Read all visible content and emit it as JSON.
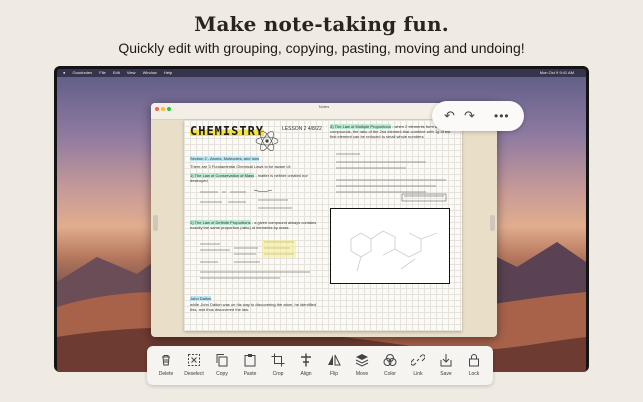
{
  "headline": "Make note-taking fun.",
  "subhead": "Quickly edit with grouping, copying, pasting, moving and undoing!",
  "menubar": {
    "items": [
      "Goodnotes",
      "File",
      "Edit",
      "View",
      "Window",
      "Help"
    ],
    "clock": "Mon Oct 9 9:41 AM"
  },
  "window": {
    "title": "Notes"
  },
  "note": {
    "title": "CHEMISTRY",
    "lesson": "LESSON 2   4/8/22",
    "section": "Section 2 - Atoms, Molecules, and Ions",
    "line1": "There are 3 Fundamental Chemical Laws to be aware of:",
    "law1": "1) The Law of Conservation of Mass",
    "law1_desc": "- matter is neither created nor destroyed",
    "law2": "2) The Law of Definite Proportions",
    "law2_desc": "- a given compound always contains exactly the same proportion (ratio) of elements by mass",
    "law3": "3) The Law of Multiple Proportions",
    "law3_desc": "- when 2 elements form a series of compounds, the ratio of the 2nd element that combine with 1g of the first element can be reduced to small whole numbers",
    "person": "John Dalton",
    "footer": "while John Dalton was on his way to discovering the atom, he identified this, and thus discovered the law."
  },
  "undo_bar": {
    "undo_icon": "undo-icon",
    "redo_icon": "redo-icon",
    "more_icon": "more-icon"
  },
  "toolbar": {
    "tools": [
      {
        "label": "Delete",
        "icon": "trash-icon"
      },
      {
        "label": "Deselect",
        "icon": "deselect-icon"
      },
      {
        "label": "Copy",
        "icon": "copy-icon"
      },
      {
        "label": "Paste",
        "icon": "paste-icon"
      },
      {
        "label": "Crop",
        "icon": "crop-icon"
      },
      {
        "label": "Align",
        "icon": "align-icon"
      },
      {
        "label": "Flip",
        "icon": "flip-icon"
      },
      {
        "label": "Move",
        "icon": "move-icon"
      },
      {
        "label": "Color",
        "icon": "color-icon"
      },
      {
        "label": "Link",
        "icon": "link-icon"
      },
      {
        "label": "Save",
        "icon": "save-icon"
      },
      {
        "label": "Lock",
        "icon": "lock-icon"
      }
    ]
  },
  "colors": {
    "background": "#efeae2",
    "highlight_yellow": "#f4ec8a",
    "highlight_green": "#b8ead0",
    "highlight_blue": "#bde4f2"
  }
}
